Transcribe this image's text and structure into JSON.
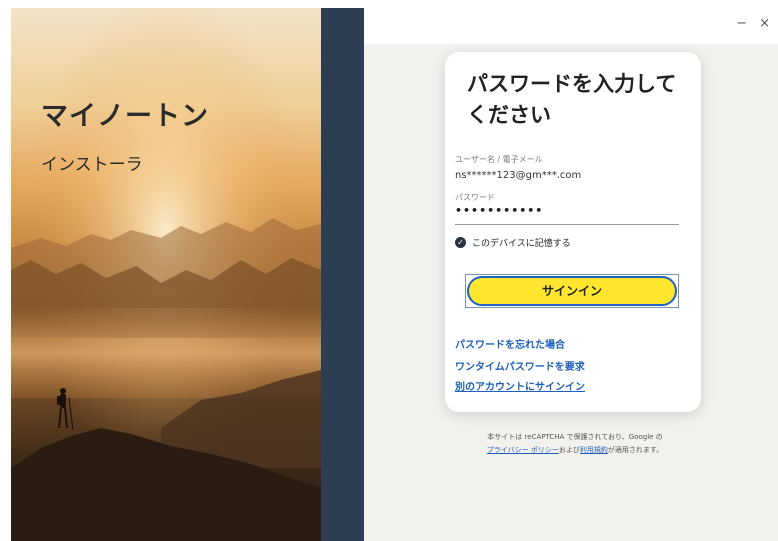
{
  "window": {
    "minimize_icon": "−",
    "close_icon": "×"
  },
  "hero": {
    "title": "マイノートン",
    "subtitle": "インストーラ"
  },
  "card": {
    "title": "パスワードを入力してください",
    "username_label": "ユーザー名 / 電子メール",
    "username_value": "ns******123@gm***.com",
    "password_label": "パスワード",
    "password_value": "•••••••••••",
    "remember_label": "このデバイスに記憶する",
    "remember_checked": true,
    "signin_label": "サインイン",
    "links": {
      "forgot": "パスワードを忘れた場合",
      "otp": "ワンタイムパスワードを要求",
      "other_account": "別のアカウントにサインイン"
    }
  },
  "recaptcha": {
    "line1": "本サイトは reCAPTCHA で保護されており、Google の",
    "privacy": "プライバシー ポリシー",
    "and": "および",
    "terms": "利用規約",
    "suffix": "が適用されます。"
  },
  "colors": {
    "accent_yellow": "#fde62d",
    "link_blue": "#1d5fbd",
    "dark_strip": "#2d3d52",
    "right_background": "#f3f1ee"
  }
}
